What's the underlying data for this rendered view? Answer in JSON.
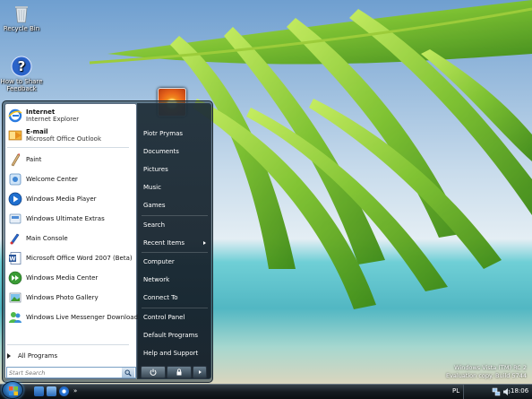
{
  "desktop": {
    "icons": [
      {
        "label": "Recycle Bin",
        "icon": "recycle-bin-icon"
      },
      {
        "label": "How to Share Feedback",
        "icon": "help-icon"
      }
    ]
  },
  "start_menu": {
    "pinned": [
      {
        "title": "Internet",
        "subtitle": "Internet Explorer",
        "icon": "internet-explorer-icon"
      },
      {
        "title": "E-mail",
        "subtitle": "Microsoft Office Outlook",
        "icon": "outlook-icon"
      }
    ],
    "recent": [
      {
        "label": "Paint",
        "icon": "paint-icon"
      },
      {
        "label": "Welcome Center",
        "icon": "welcome-center-icon"
      },
      {
        "label": "Windows Media Player",
        "icon": "media-player-icon"
      },
      {
        "label": "Windows Ultimate Extras",
        "icon": "ultimate-extras-icon"
      },
      {
        "label": "Main Console",
        "icon": "main-console-icon"
      },
      {
        "label": "Microsoft Office Word 2007 (Beta)",
        "icon": "word-icon"
      },
      {
        "label": "Windows Media Center",
        "icon": "media-center-icon"
      },
      {
        "label": "Windows Photo Gallery",
        "icon": "photo-gallery-icon"
      },
      {
        "label": "Windows Live Messenger Download",
        "icon": "messenger-icon"
      }
    ],
    "all_programs": "All Programs",
    "search_placeholder": "Start Search",
    "right": {
      "user": "Piotr Prymas",
      "documents": "Documents",
      "pictures": "Pictures",
      "music": "Music",
      "games": "Games",
      "search": "Search",
      "recent_items": "Recent Items",
      "computer": "Computer",
      "network": "Network",
      "connect_to": "Connect To",
      "control_panel": "Control Panel",
      "default_programs": "Default Programs",
      "help_support": "Help and Support"
    }
  },
  "watermark": {
    "line1": "Windows Vista (TM) RC 2",
    "line2": "Evaluation copy. Build 5744"
  },
  "taskbar": {
    "language": "PL",
    "clock": "18:06"
  },
  "colors": {
    "taskbar": "#151b20",
    "start_right_pane": "#1e2d37",
    "accent": "#2f78c0"
  }
}
